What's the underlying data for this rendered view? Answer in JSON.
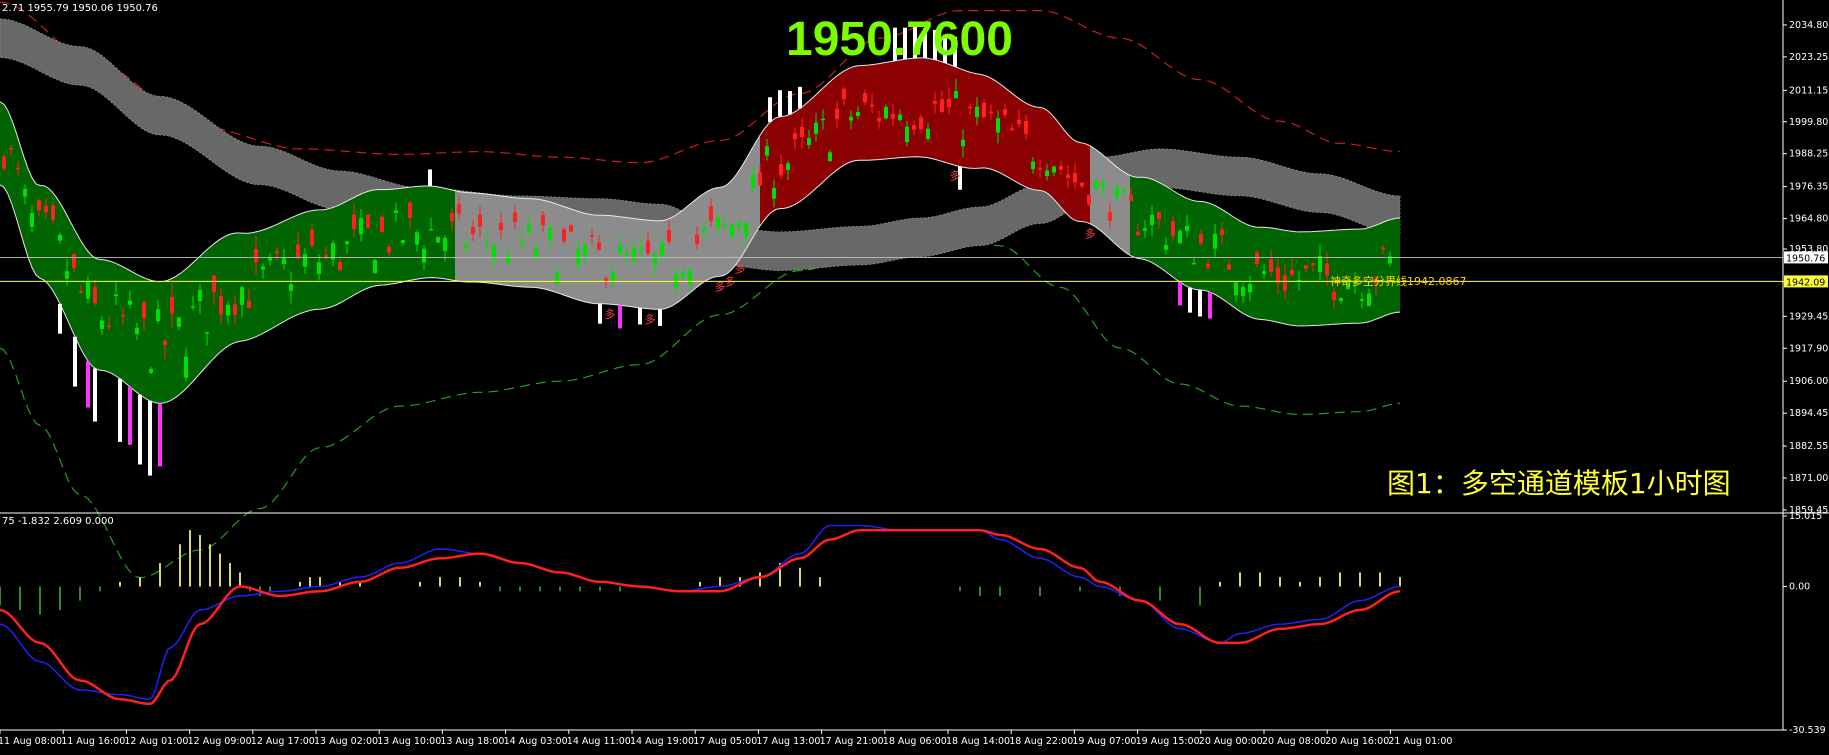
{
  "header": {
    "main_values": "2.71 1955.79 1950.06 1950.76",
    "sub_values": "75 -1.832 2.609 0.000"
  },
  "big_price": "1950.7600",
  "caption": "图1：多空通道模板1小时图",
  "level_label": "神奇多空分界线1942.0867",
  "colors": {
    "background": "#000000",
    "bull_fill": "#006400",
    "bear_fill": "#8B0000",
    "neutral_fill": "#8C8C8C",
    "ribbon": "#6E6E6E",
    "candle_up": "#00E000",
    "candle_down": "#FF2020",
    "white_bar": "#FFFFFF",
    "magenta_bar": "#FF33FF",
    "outer_upper": "#C81E1E",
    "outer_lower": "#1EA01E",
    "level_line": "#FFFF33",
    "macd_line": "#FF2020",
    "signal_line": "#2020FF",
    "hist_pos": "#D8D870",
    "hist_neg": "#2E8B2E"
  },
  "chart_data": [
    {
      "type": "candlestick",
      "title": "",
      "ylim": [
        1859.45,
        2040.2
      ],
      "y_ticks": [
        2034.8,
        2023.25,
        2011.15,
        1999.8,
        1988.25,
        1976.35,
        1964.8,
        1953.8,
        1941.9,
        1929.45,
        1917.9,
        1906.0,
        1894.45,
        1882.55,
        1871.0,
        1859.45
      ],
      "y_tick_labels": [
        "2034.80",
        "2023.25",
        "2011.15",
        "1999.80",
        "1988.25",
        "1976.35",
        "1964.80",
        "1953.80",
        "",
        "1929.45",
        "1917.90",
        "1906.00",
        "1894.45",
        "1882.55",
        "1871.00",
        "1859.45"
      ],
      "current_price_label": "1950.76",
      "current_price": 1950.76,
      "level_value_label": "1942.09",
      "level_value": 1942.09,
      "anchors": {
        "mid": [
          [
            0,
            1992
          ],
          [
            40,
            1960
          ],
          [
            100,
            1930
          ],
          [
            160,
            1920
          ],
          [
            240,
            1940
          ],
          [
            320,
            1950
          ],
          [
            380,
            1958
          ],
          [
            430,
            1960
          ],
          [
            470,
            1958
          ],
          [
            530,
            1956
          ],
          [
            600,
            1950
          ],
          [
            660,
            1948
          ],
          [
            720,
            1960
          ],
          [
            780,
            1985
          ],
          [
            860,
            2003
          ],
          [
            920,
            2005
          ],
          [
            980,
            2000
          ],
          [
            1040,
            1990
          ],
          [
            1080,
            1978
          ],
          [
            1140,
            1965
          ],
          [
            1200,
            1955
          ],
          [
            1260,
            1945
          ],
          [
            1300,
            1943
          ],
          [
            1360,
            1944
          ],
          [
            1400,
            1948
          ]
        ],
        "half_width": [
          [
            0,
            15
          ],
          [
            100,
            20
          ],
          [
            160,
            22
          ],
          [
            300,
            18
          ],
          [
            500,
            16
          ],
          [
            600,
            16
          ],
          [
            700,
            16
          ],
          [
            840,
            17
          ],
          [
            940,
            18
          ],
          [
            1040,
            15
          ],
          [
            1100,
            14
          ],
          [
            1200,
            16
          ],
          [
            1300,
            17
          ],
          [
            1400,
            17
          ]
        ],
        "ribbon_mid": [
          [
            0,
            2030
          ],
          [
            80,
            2020
          ],
          [
            160,
            2002
          ],
          [
            260,
            1984
          ],
          [
            340,
            1975
          ],
          [
            420,
            1969
          ],
          [
            520,
            1966
          ],
          [
            600,
            1965
          ],
          [
            660,
            1963
          ],
          [
            720,
            1955
          ],
          [
            780,
            1953
          ],
          [
            860,
            1955
          ],
          [
            920,
            1958
          ],
          [
            980,
            1962
          ],
          [
            1040,
            1970
          ],
          [
            1100,
            1980
          ],
          [
            1160,
            1983
          ],
          [
            1240,
            1980
          ],
          [
            1320,
            1974
          ],
          [
            1400,
            1966
          ]
        ],
        "ribbon_half_width": [
          [
            0,
            7
          ],
          [
            1400,
            7
          ]
        ],
        "outer_upper": [
          [
            0,
            2043
          ],
          [
            100,
            2020
          ],
          [
            200,
            1998
          ],
          [
            300,
            1990
          ],
          [
            400,
            1988
          ],
          [
            480,
            1989
          ],
          [
            560,
            1987
          ],
          [
            640,
            1985
          ],
          [
            720,
            1993
          ],
          [
            800,
            2010
          ],
          [
            880,
            2030
          ],
          [
            960,
            2040
          ],
          [
            1040,
            2040
          ],
          [
            1120,
            2030
          ],
          [
            1200,
            2015
          ],
          [
            1280,
            2000
          ],
          [
            1340,
            1992
          ],
          [
            1400,
            1989
          ]
        ],
        "outer_lower": [
          [
            0,
            1918
          ],
          [
            40,
            1890
          ],
          [
            80,
            1865
          ],
          [
            140,
            1835
          ],
          [
            200,
            1845
          ],
          [
            260,
            1860
          ],
          [
            320,
            1882
          ],
          [
            400,
            1897
          ],
          [
            480,
            1902
          ],
          [
            560,
            1906
          ],
          [
            640,
            1912
          ],
          [
            720,
            1930
          ],
          [
            800,
            1946
          ],
          [
            880,
            1955
          ],
          [
            960,
            1958
          ],
          [
            1000,
            1955
          ],
          [
            1060,
            1940
          ],
          [
            1120,
            1918
          ],
          [
            1180,
            1905
          ],
          [
            1240,
            1897
          ],
          [
            1300,
            1894
          ],
          [
            1360,
            1895
          ],
          [
            1400,
            1898
          ]
        ],
        "shade_segments": [
          [
            0,
            455,
            "bull"
          ],
          [
            455,
            760,
            "neutral"
          ],
          [
            760,
            1090,
            "bear"
          ],
          [
            1090,
            1130,
            "neutral"
          ],
          [
            1130,
            1400,
            "bull"
          ]
        ],
        "vertical_spikes": [
          [
            60,
            -18
          ],
          [
            75,
            -30
          ],
          [
            88,
            -28
          ],
          [
            95,
            -32
          ],
          [
            120,
            -38
          ],
          [
            130,
            -35
          ],
          [
            140,
            -42
          ],
          [
            150,
            -45
          ],
          [
            160,
            -38
          ],
          [
            430,
            10
          ],
          [
            600,
            -12
          ],
          [
            620,
            -14
          ],
          [
            640,
            -10
          ],
          [
            660,
            -10
          ],
          [
            770,
            15
          ],
          [
            780,
            16
          ],
          [
            790,
            14
          ],
          [
            800,
            13
          ],
          [
            895,
            20
          ],
          [
            905,
            19
          ],
          [
            915,
            19
          ],
          [
            925,
            18
          ],
          [
            935,
            18
          ],
          [
            945,
            17
          ],
          [
            955,
            18
          ],
          [
            960,
            -14
          ],
          [
            1180,
            -14
          ],
          [
            1190,
            -15
          ],
          [
            1200,
            -16
          ],
          [
            1210,
            -16
          ]
        ]
      },
      "annotations": [
        "多",
        "多",
        "多",
        "多",
        "多",
        "多",
        "多"
      ],
      "x_tick_labels": [
        "11 Aug 08:00",
        "11 Aug 16:00",
        "12 Aug 01:00",
        "12 Aug 09:00",
        "12 Aug 17:00",
        "13 Aug 02:00",
        "13 Aug 10:00",
        "13 Aug 18:00",
        "14 Aug 03:00",
        "14 Aug 11:00",
        "14 Aug 19:00",
        "17 Aug 05:00",
        "17 Aug 13:00",
        "17 Aug 21:00",
        "18 Aug 06:00",
        "18 Aug 14:00",
        "18 Aug 22:00",
        "19 Aug 07:00",
        "19 Aug 15:00",
        "20 Aug 00:00",
        "20 Aug 08:00",
        "20 Aug 16:00",
        "21 Aug 01:00"
      ]
    },
    {
      "type": "line",
      "title": "",
      "ylim": [
        -30.539,
        15.015
      ],
      "y_tick_labels": [
        "15.015",
        "0.00",
        "-30.539"
      ],
      "y_ticks": [
        15.015,
        0,
        -30.539
      ],
      "series": [
        {
          "key": "macd",
          "points": [
            [
              0,
              -5
            ],
            [
              40,
              -12
            ],
            [
              80,
              -20
            ],
            [
              120,
              -24
            ],
            [
              150,
              -25
            ],
            [
              170,
              -20
            ],
            [
              200,
              -8
            ],
            [
              240,
              0
            ],
            [
              280,
              -2
            ],
            [
              320,
              -1
            ],
            [
              360,
              1
            ],
            [
              400,
              4
            ],
            [
              440,
              6
            ],
            [
              480,
              7
            ],
            [
              520,
              5
            ],
            [
              560,
              3
            ],
            [
              600,
              1
            ],
            [
              640,
              0
            ],
            [
              680,
              -1
            ],
            [
              720,
              -1
            ],
            [
              760,
              2
            ],
            [
              800,
              6
            ],
            [
              830,
              10
            ],
            [
              860,
              12
            ],
            [
              900,
              12
            ],
            [
              940,
              12
            ],
            [
              980,
              12
            ],
            [
              1000,
              11
            ],
            [
              1040,
              8
            ],
            [
              1080,
              4
            ],
            [
              1100,
              1
            ],
            [
              1140,
              -3
            ],
            [
              1180,
              -8
            ],
            [
              1220,
              -12
            ],
            [
              1240,
              -12
            ],
            [
              1280,
              -9
            ],
            [
              1320,
              -8
            ],
            [
              1360,
              -5
            ],
            [
              1400,
              -1
            ]
          ]
        },
        {
          "key": "signal",
          "points": [
            [
              0,
              -8
            ],
            [
              40,
              -16
            ],
            [
              80,
              -22
            ],
            [
              120,
              -23
            ],
            [
              150,
              -24
            ],
            [
              170,
              -13
            ],
            [
              200,
              -5
            ],
            [
              240,
              -2
            ],
            [
              280,
              -1
            ],
            [
              320,
              0
            ],
            [
              360,
              2
            ],
            [
              400,
              5
            ],
            [
              440,
              8
            ],
            [
              480,
              7
            ],
            [
              520,
              5
            ],
            [
              560,
              3
            ],
            [
              600,
              1
            ],
            [
              640,
              0
            ],
            [
              680,
              -1
            ],
            [
              720,
              0
            ],
            [
              760,
              2
            ],
            [
              800,
              7
            ],
            [
              830,
              13
            ],
            [
              860,
              13
            ],
            [
              900,
              12
            ],
            [
              940,
              12
            ],
            [
              980,
              12
            ],
            [
              1000,
              10
            ],
            [
              1040,
              6
            ],
            [
              1080,
              2
            ],
            [
              1100,
              0
            ],
            [
              1140,
              -3
            ],
            [
              1180,
              -9
            ],
            [
              1220,
              -12
            ],
            [
              1240,
              -10
            ],
            [
              1280,
              -8
            ],
            [
              1320,
              -7
            ],
            [
              1360,
              -3
            ],
            [
              1400,
              0
            ]
          ]
        }
      ],
      "histogram": [
        [
          0,
          -4
        ],
        [
          20,
          -5
        ],
        [
          40,
          -6
        ],
        [
          60,
          -5
        ],
        [
          80,
          -3
        ],
        [
          100,
          -1
        ],
        [
          120,
          1
        ],
        [
          140,
          2
        ],
        [
          160,
          5
        ],
        [
          180,
          9
        ],
        [
          190,
          12
        ],
        [
          200,
          11
        ],
        [
          210,
          9
        ],
        [
          220,
          7
        ],
        [
          230,
          5
        ],
        [
          240,
          3
        ],
        [
          250,
          -1
        ],
        [
          260,
          -2
        ],
        [
          270,
          -1
        ],
        [
          300,
          1
        ],
        [
          310,
          2
        ],
        [
          320,
          2
        ],
        [
          340,
          1
        ],
        [
          360,
          1
        ],
        [
          380,
          0
        ],
        [
          420,
          1
        ],
        [
          440,
          2
        ],
        [
          460,
          2
        ],
        [
          480,
          1
        ],
        [
          500,
          -1
        ],
        [
          520,
          -1
        ],
        [
          540,
          -1
        ],
        [
          560,
          -1
        ],
        [
          580,
          -1
        ],
        [
          600,
          -1
        ],
        [
          620,
          -1
        ],
        [
          660,
          0
        ],
        [
          700,
          1
        ],
        [
          720,
          2
        ],
        [
          740,
          2
        ],
        [
          760,
          3
        ],
        [
          780,
          5
        ],
        [
          800,
          4
        ],
        [
          820,
          2
        ],
        [
          840,
          0
        ],
        [
          880,
          0
        ],
        [
          920,
          0
        ],
        [
          960,
          -1
        ],
        [
          980,
          -2
        ],
        [
          1000,
          -2
        ],
        [
          1040,
          -2
        ],
        [
          1080,
          -1
        ],
        [
          1120,
          -2
        ],
        [
          1160,
          -3
        ],
        [
          1200,
          -4
        ],
        [
          1220,
          1
        ],
        [
          1240,
          3
        ],
        [
          1260,
          3
        ],
        [
          1280,
          2
        ],
        [
          1300,
          1
        ],
        [
          1320,
          2
        ],
        [
          1340,
          3
        ],
        [
          1360,
          3
        ],
        [
          1380,
          3
        ],
        [
          1400,
          2
        ]
      ]
    }
  ]
}
